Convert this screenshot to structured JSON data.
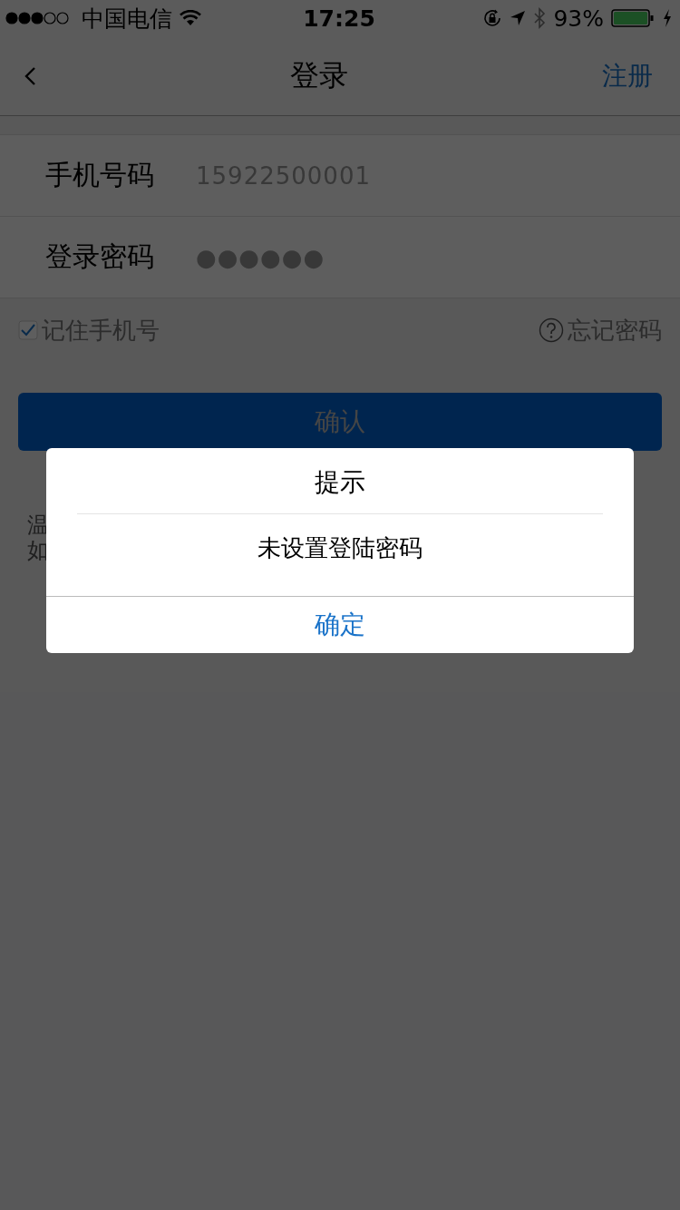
{
  "status_bar": {
    "carrier": "中国电信",
    "time": "17:25",
    "battery": "93%"
  },
  "nav": {
    "title": "登录",
    "action": "注册"
  },
  "fields": [
    {
      "label": "手机号码",
      "value": "15922500001"
    },
    {
      "label": "登录密码",
      "value": "●●●●●●"
    }
  ],
  "remember": {
    "label": "记住手机号",
    "checked": true
  },
  "forgot": "忘记密码",
  "submit": "确认",
  "tips": [
    "温",
    "如"
  ],
  "dialog": {
    "title": "提示",
    "message": "未设置登陆密码",
    "button": "确定"
  }
}
